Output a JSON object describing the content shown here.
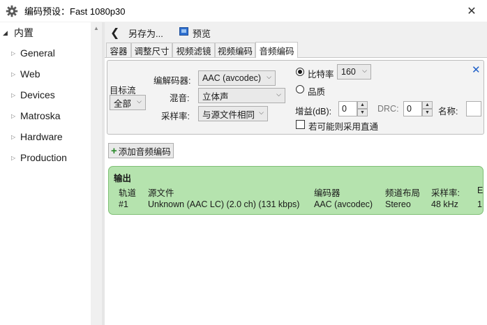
{
  "window": {
    "title": "编码预设：Fast 1080p30",
    "close_glyph": "✕"
  },
  "sidebar": {
    "root_label": "内置",
    "items": [
      {
        "label": "General"
      },
      {
        "label": "Web"
      },
      {
        "label": "Devices"
      },
      {
        "label": "Matroska"
      },
      {
        "label": "Hardware"
      },
      {
        "label": "Production"
      }
    ]
  },
  "toolbar": {
    "save_as_label": "另存为...",
    "preview_label": "预览"
  },
  "tabs": [
    {
      "label": "容器",
      "active": false
    },
    {
      "label": "调整尺寸",
      "active": false
    },
    {
      "label": "视频滤镜",
      "active": false
    },
    {
      "label": "视频编码",
      "active": false
    },
    {
      "label": "音频编码",
      "active": true
    }
  ],
  "audio_track": {
    "target_stream_label": "目标流",
    "target_stream_value": "全部",
    "codec_label": "编解码器:",
    "codec_value": "AAC (avcodec)",
    "mixdown_label": "混音:",
    "mixdown_value": "立体声",
    "samplerate_label": "采样率:",
    "samplerate_value": "与源文件相同",
    "bitrate_label": "比特率",
    "bitrate_value": "160",
    "bitrate_selected": true,
    "quality_label": "品质",
    "gain_label": "增益(dB):",
    "gain_value": "0",
    "drc_label": "DRC:",
    "drc_value": "0",
    "name_label": "名称:",
    "passthru_label": "若可能则采用直通",
    "passthru_checked": false
  },
  "add_audio_label": "添加音频编码",
  "output": {
    "title": "输出",
    "headers": [
      "轨道",
      "源文件",
      "编码器",
      "频道布局",
      "采样率:",
      "E"
    ],
    "row": [
      "#1",
      "Unknown (AAC LC) (2.0 ch) (131 kbps)",
      "AAC (avcodec)",
      "Stereo",
      "48 kHz",
      "1"
    ]
  },
  "colors": {
    "output_bg": "#b5e3ae",
    "remove_icon": "#1e5fc8",
    "add_icon": "#2a8a2a"
  }
}
